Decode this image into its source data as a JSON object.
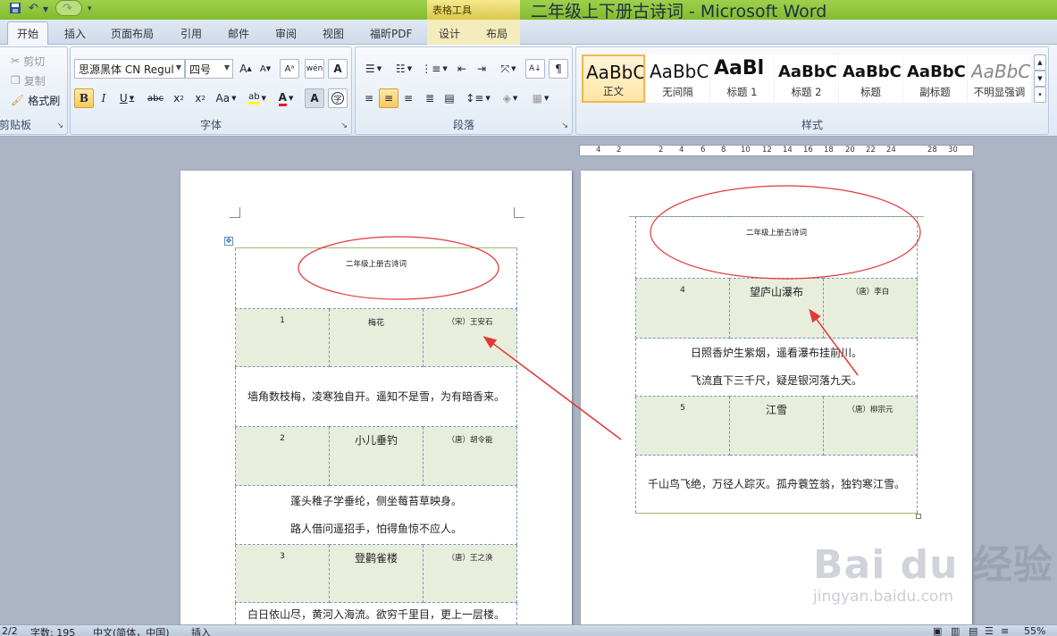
{
  "titlebar": {
    "document_title": "二年级上下册古诗词 - Microsoft Word",
    "contextual_tab_group": "表格工具"
  },
  "tabs": [
    "开始",
    "插入",
    "页面布局",
    "引用",
    "邮件",
    "审阅",
    "视图",
    "福昕PDF",
    "设计",
    "布局"
  ],
  "active_tab": "开始",
  "ribbon": {
    "clipboard": {
      "cut": "剪切",
      "copy": "复制",
      "format_painter": "格式刷",
      "label": "剪贴板"
    },
    "font": {
      "family": "思源黑体 CN Regul",
      "size": "四号",
      "label": "字体"
    },
    "paragraph": {
      "label": "段落"
    },
    "styles": {
      "label": "样式",
      "items": [
        {
          "sample": "AaBbC",
          "name": "正文"
        },
        {
          "sample": "AaBbC",
          "name": "无间隔"
        },
        {
          "sample": "AaBl",
          "name": "标题 1"
        },
        {
          "sample": "AaBbC",
          "name": "标题 2"
        },
        {
          "sample": "AaBbC",
          "name": "标题"
        },
        {
          "sample": "AaBbC",
          "name": "副标题"
        },
        {
          "sample": "AaBbC",
          "name": "不明显强调"
        }
      ]
    }
  },
  "ruler_ticks": [
    "4",
    "2",
    "2",
    "4",
    "6",
    "8",
    "10",
    "12",
    "14",
    "16",
    "18",
    "20",
    "22",
    "24",
    "28",
    "30"
  ],
  "document": {
    "page1": {
      "header": "二年级上册古诗词",
      "poems": [
        {
          "num": "1",
          "title": "梅花",
          "author": "（宋）王安石",
          "lines": [
            "墙角数枝梅，凌寒独自开。遥知不是雪，为有暗香来。"
          ]
        },
        {
          "num": "2",
          "title": "小儿垂钓",
          "author": "（唐）胡令能",
          "lines": [
            "蓬头稚子学垂纶，侧坐莓苔草映身。",
            "路人借问遥招手，怕得鱼惊不应人。"
          ]
        },
        {
          "num": "3",
          "title": "登鹳雀楼",
          "author": "（唐）王之涣",
          "lines": [
            "白日依山尽，黄河入海流。欲穷千里目，更上一层楼。"
          ]
        }
      ]
    },
    "page2": {
      "header": "二年级上册古诗词",
      "poems": [
        {
          "num": "4",
          "title": "望庐山瀑布",
          "author": "（唐）李白",
          "lines": [
            "日照香炉生紫烟，遥看瀑布挂前川。",
            "飞流直下三千尺，疑是银河落九天。"
          ]
        },
        {
          "num": "5",
          "title": "江雪",
          "author": "（唐）柳宗元",
          "lines": [
            "千山鸟飞绝，万径人踪灭。孤舟蓑笠翁，独钓寒江雪。"
          ]
        }
      ]
    }
  },
  "statusbar": {
    "page": "2/2",
    "word_count": "字数: 195",
    "language": "中文(简体，中国)",
    "mode": "插入",
    "zoom": "55%"
  },
  "watermark": {
    "logo": "Bai du 经验",
    "url": "jingyan.baidu.com"
  },
  "colors": {
    "annotation": "#e0393a",
    "title_bar": "#8fc23d",
    "cell_shade": "#e8eedc"
  }
}
